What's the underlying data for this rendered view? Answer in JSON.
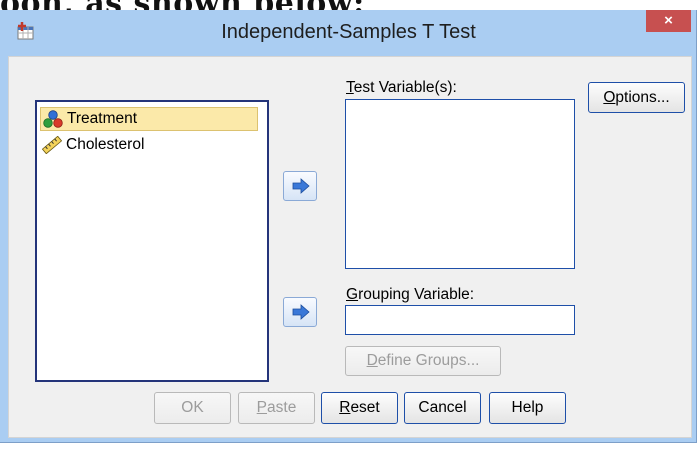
{
  "caption": "oon, as shown below:",
  "window": {
    "title": "Independent-Samples T Test",
    "close_label": "×"
  },
  "variables": {
    "items": [
      {
        "label": "Treatment",
        "type": "nominal",
        "selected": true
      },
      {
        "label": "Cholesterol",
        "type": "scale",
        "selected": false
      }
    ]
  },
  "test_variables": {
    "label_first": "T",
    "label_rest": "est Variable(s):"
  },
  "grouping_variable": {
    "label_first": "G",
    "label_rest": "rouping Variable:",
    "value": ""
  },
  "buttons": {
    "options_first": "O",
    "options_rest": "ptions...",
    "define_first": "D",
    "define_rest": "efine Groups...",
    "ok": "OK",
    "paste_first": "P",
    "paste_rest": "aste",
    "reset_first": "R",
    "reset_rest": "eset",
    "cancel": "Cancel",
    "help": "Help"
  },
  "icons": {
    "move_arrow": "right-arrow-icon",
    "app": "spss-dialog-icon",
    "nominal": "nominal-variable-icon",
    "scale": "scale-variable-icon"
  },
  "colors": {
    "frame": "#aacdf2",
    "close": "#c75050",
    "selection": "#fbe9a9",
    "arrow": "#3a78d8"
  }
}
